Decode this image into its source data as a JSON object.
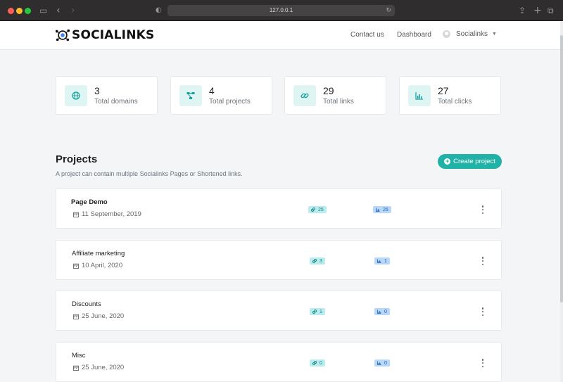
{
  "browser": {
    "url": "127.0.0.1"
  },
  "navbar": {
    "brand": "SOCIALINKS",
    "links": [
      "Contact us",
      "Dashboard"
    ],
    "user": "Socialinks"
  },
  "stats": [
    {
      "value": "3",
      "label": "Total domains",
      "icon": "globe-icon"
    },
    {
      "value": "4",
      "label": "Total projects",
      "icon": "project-diagram-icon"
    },
    {
      "value": "29",
      "label": "Total links",
      "icon": "link-icon"
    },
    {
      "value": "27",
      "label": "Total clicks",
      "icon": "chart-icon"
    }
  ],
  "projects": {
    "title": "Projects",
    "description": "A project can contain multiple Socialinks Pages or Shortened links.",
    "create_label": "Create project",
    "items": [
      {
        "name": "Page Demo",
        "date": "11 September, 2019",
        "links": "25",
        "clicks": "26"
      },
      {
        "name": "Affiliate marketing",
        "date": "10 April, 2020",
        "links": "3",
        "clicks": "1"
      },
      {
        "name": "Discounts",
        "date": "25 June, 2020",
        "links": "1",
        "clicks": "0"
      },
      {
        "name": "Misc",
        "date": "25 June, 2020",
        "links": "0",
        "clicks": "0"
      }
    ]
  },
  "colors": {
    "accent": "#20b2a6",
    "link_badge": "#b8ecef",
    "click_badge": "#b7d7fb"
  }
}
